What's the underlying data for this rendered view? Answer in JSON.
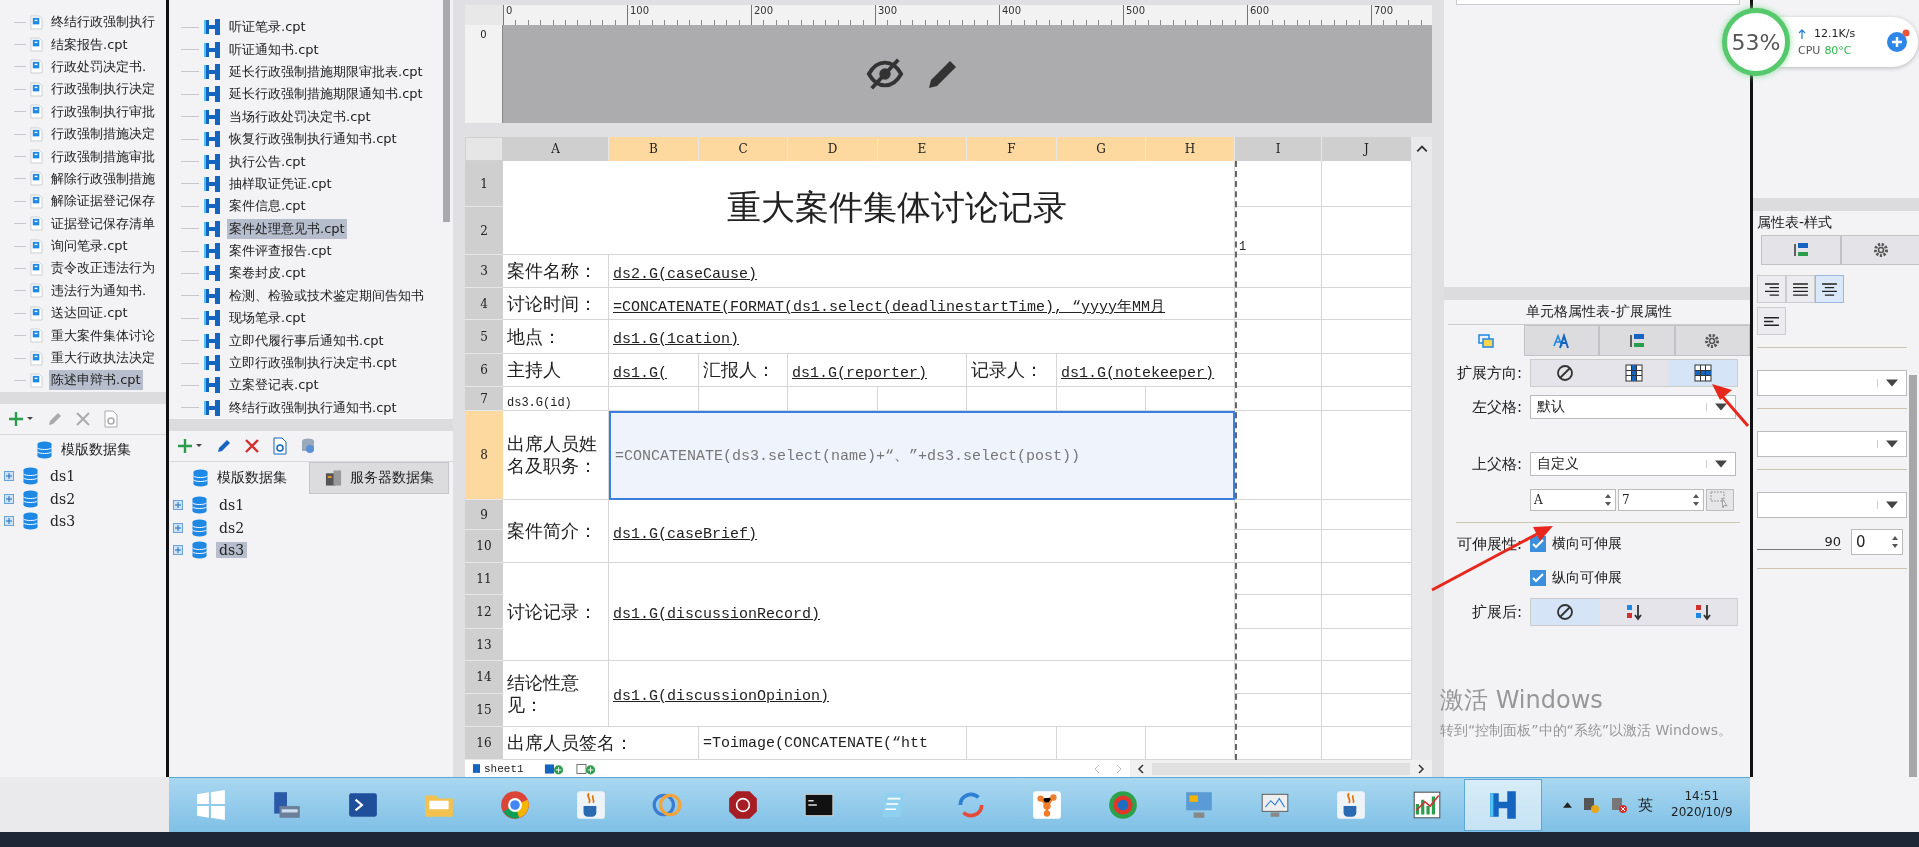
{
  "left_panel": {
    "files": [
      {
        "label": "终结行政强制执行",
        "selected": false
      },
      {
        "label": "结案报告.cpt",
        "selected": false
      },
      {
        "label": "行政处罚决定书.",
        "selected": false
      },
      {
        "label": "行政强制执行决定",
        "selected": false
      },
      {
        "label": "行政强制执行审批",
        "selected": false
      },
      {
        "label": "行政强制措施决定",
        "selected": false
      },
      {
        "label": "行政强制措施审批",
        "selected": false
      },
      {
        "label": "解除行政强制措施",
        "selected": false
      },
      {
        "label": "解除证据登记保存",
        "selected": false
      },
      {
        "label": "证据登记保存清单",
        "selected": false
      },
      {
        "label": "询问笔录.cpt",
        "selected": false
      },
      {
        "label": "责令改正违法行为",
        "selected": false
      },
      {
        "label": "违法行为通知书.",
        "selected": false
      },
      {
        "label": "送达回证.cpt",
        "selected": false
      },
      {
        "label": "重大案件集体讨论",
        "selected": false
      },
      {
        "label": "重大行政执法决定",
        "selected": false
      },
      {
        "label": "陈述申辩书.cpt",
        "selected": true
      }
    ],
    "dataset_tab": "模版数据集",
    "datasets": [
      "ds1",
      "ds2",
      "ds3"
    ]
  },
  "middle_panel": {
    "files": [
      {
        "label": "听证笔录.cpt",
        "selected": false
      },
      {
        "label": "听证通知书.cpt",
        "selected": false
      },
      {
        "label": "延长行政强制措施期限审批表.cpt",
        "selected": false
      },
      {
        "label": "延长行政强制措施期限通知书.cpt",
        "selected": false
      },
      {
        "label": "当场行政处罚决定书.cpt",
        "selected": false
      },
      {
        "label": "恢复行政强制执行通知书.cpt",
        "selected": false
      },
      {
        "label": "执行公告.cpt",
        "selected": false
      },
      {
        "label": "抽样取证凭证.cpt",
        "selected": false
      },
      {
        "label": "案件信息.cpt",
        "selected": false
      },
      {
        "label": "案件处理意见书.cpt",
        "selected": true
      },
      {
        "label": "案件评查报告.cpt",
        "selected": false
      },
      {
        "label": "案卷封皮.cpt",
        "selected": false
      },
      {
        "label": "检测、检验或技术鉴定期间告知书",
        "selected": false
      },
      {
        "label": "现场笔录.cpt",
        "selected": false
      },
      {
        "label": "立即代履行事后通知书.cpt",
        "selected": false
      },
      {
        "label": "立即行政强制执行决定书.cpt",
        "selected": false
      },
      {
        "label": "立案登记表.cpt",
        "selected": false
      },
      {
        "label": "终结行政强制执行通知书.cpt",
        "selected": false
      }
    ],
    "tabs": [
      {
        "label": "模版数据集",
        "selected": true
      },
      {
        "label": "服务器数据集",
        "selected": false
      }
    ],
    "datasets": [
      {
        "label": "ds1",
        "selected": false
      },
      {
        "label": "ds2",
        "selected": false
      },
      {
        "label": "ds3",
        "selected": true
      }
    ]
  },
  "designer": {
    "ruler_marks": [
      "0",
      "100",
      "200",
      "300",
      "400",
      "500",
      "600",
      "700"
    ],
    "vertical_ruler_mark": "0",
    "columns": [
      {
        "label": "A",
        "selected": false
      },
      {
        "label": "B",
        "selected": true
      },
      {
        "label": "C",
        "selected": true
      },
      {
        "label": "D",
        "selected": true
      },
      {
        "label": "E",
        "selected": true
      },
      {
        "label": "F",
        "selected": true
      },
      {
        "label": "G",
        "selected": true
      },
      {
        "label": "H",
        "selected": true
      },
      {
        "label": "I",
        "selected": false
      },
      {
        "label": "J",
        "selected": false
      }
    ],
    "rows": [
      {
        "label": "1",
        "selected": false
      },
      {
        "label": "2",
        "selected": false
      },
      {
        "label": "3",
        "selected": false
      },
      {
        "label": "4",
        "selected": false
      },
      {
        "label": "5",
        "selected": false
      },
      {
        "label": "6",
        "selected": false
      },
      {
        "label": "7",
        "selected": false
      },
      {
        "label": "8",
        "selected": true
      },
      {
        "label": "9",
        "selected": false
      },
      {
        "label": "10",
        "selected": false
      },
      {
        "label": "11",
        "selected": false
      },
      {
        "label": "12",
        "selected": false
      },
      {
        "label": "13",
        "selected": false
      },
      {
        "label": "14",
        "selected": false
      },
      {
        "label": "15",
        "selected": false
      },
      {
        "label": "16",
        "selected": false
      }
    ],
    "cells": [
      {
        "kind": "title",
        "text": "重大案件集体讨论记录",
        "selected": false
      },
      {
        "kind": "note",
        "text": "1",
        "selected": false
      },
      {
        "kind": "label",
        "text": "案件名称：",
        "selected": false
      },
      {
        "kind": "binding",
        "text": "ds2.G(caseCause)",
        "selected": false
      },
      {
        "kind": "label",
        "text": "讨论时间：",
        "selected": false
      },
      {
        "kind": "binding",
        "text": "=CONCATENATE(FORMAT(ds1.select(deadlinestartTime), “yyyy年MM月",
        "selected": false
      },
      {
        "kind": "label",
        "text": "地点：",
        "selected": false
      },
      {
        "kind": "binding",
        "text": "ds1.G(1cation)",
        "selected": false
      },
      {
        "kind": "label",
        "text": "主持人",
        "selected": false
      },
      {
        "kind": "binding",
        "text": "ds1.G(",
        "selected": false
      },
      {
        "kind": "label",
        "text": "汇报人：",
        "selected": false
      },
      {
        "kind": "binding",
        "text": "ds1.G(reporter)",
        "selected": false
      },
      {
        "kind": "label",
        "text": "记录人：",
        "selected": false
      },
      {
        "kind": "binding",
        "text": "ds1.G(notekeeper)",
        "selected": false
      },
      {
        "kind": "note",
        "text": "ds3.G(id)",
        "selected": false
      },
      {
        "kind": "label",
        "text": "出席人员姓名及职务：",
        "selected": false
      },
      {
        "kind": "expression",
        "text": "=CONCATENATE(ds3.select(name)+“、”+ds3.select(post))",
        "selected": true
      },
      {
        "kind": "label",
        "text": "案件简介：",
        "selected": false
      },
      {
        "kind": "binding",
        "text": "ds1.G(caseBrief)",
        "selected": false
      },
      {
        "kind": "label",
        "text": "讨论记录：",
        "selected": false
      },
      {
        "kind": "binding",
        "text": "ds1.G(discussionRecord)",
        "selected": false
      },
      {
        "kind": "label",
        "text": "结论性意见：",
        "selected": false
      },
      {
        "kind": "binding",
        "text": "ds1.G(discussionOpinion)",
        "selected": false
      },
      {
        "kind": "label",
        "text": "出席人员签名：",
        "selected": false
      },
      {
        "kind": "expression",
        "text": "=Toimage(CONCATENATE(“htt",
        "selected": false
      }
    ],
    "sheet_tab": "sheet1"
  },
  "widget": {
    "percent": "53%",
    "speed": "12.1K/s",
    "cpu_label": "CPU",
    "cpu_temp": "80°C"
  },
  "cell_properties": {
    "title": "单元格属性表-扩展属性",
    "tabs": [
      {
        "kind": "cell",
        "selected": true
      },
      {
        "kind": "font",
        "selected": false
      },
      {
        "kind": "layout",
        "selected": false
      },
      {
        "kind": "settings",
        "selected": false
      }
    ],
    "expand_direction": {
      "label": "扩展方向:",
      "options": [
        {
          "kind": "none",
          "selected": false
        },
        {
          "kind": "vertical",
          "selected": false
        },
        {
          "kind": "horizontal",
          "selected": true
        }
      ]
    },
    "left_parent": {
      "label": "左父格:",
      "value": "默认"
    },
    "top_parent": {
      "label": "上父格:",
      "value": "自定义",
      "column": "A",
      "row": "7"
    },
    "extensibility": {
      "label": "可伸展性:",
      "options": [
        {
          "label": "横向可伸展",
          "checked": true
        },
        {
          "label": "纵向可伸展",
          "checked": true
        }
      ]
    },
    "after_expand": {
      "label": "扩展后:",
      "options": [
        {
          "kind": "none",
          "selected": true
        },
        {
          "kind": "ascending",
          "selected": false
        },
        {
          "kind": "descending",
          "selected": false
        }
      ]
    }
  },
  "style_panel": {
    "title": "属性表-样式",
    "alignments": [
      {
        "kind": "right",
        "selected": false
      },
      {
        "kind": "justify",
        "selected": false
      },
      {
        "kind": "center",
        "selected": true
      }
    ],
    "rotation_reading": "90",
    "rotation_value": "0"
  },
  "watermark": {
    "title": "激活 Windows",
    "hint": "转到“控制面板”中的“系统”以激活 Windows。"
  },
  "taskbar": {
    "apps": [
      {
        "kind": "start",
        "selected": false
      },
      {
        "kind": "server",
        "selected": false
      },
      {
        "kind": "terminal",
        "selected": false
      },
      {
        "kind": "folder",
        "selected": false
      },
      {
        "kind": "browser",
        "selected": false
      },
      {
        "kind": "java",
        "selected": false
      },
      {
        "kind": "rings",
        "selected": false
      },
      {
        "kind": "redapp",
        "selected": false
      },
      {
        "kind": "console",
        "selected": false
      },
      {
        "kind": "notepad",
        "selected": false
      },
      {
        "kind": "sync",
        "selected": false
      },
      {
        "kind": "network",
        "selected": false
      },
      {
        "kind": "disc",
        "selected": false
      },
      {
        "kind": "remote",
        "selected": false
      },
      {
        "kind": "monitor",
        "selected": false
      },
      {
        "kind": "java",
        "selected": false
      },
      {
        "kind": "chart",
        "selected": false
      },
      {
        "kind": "designer",
        "selected": true
      }
    ],
    "ime": "英",
    "time": "14:51",
    "date": "2020/10/9"
  }
}
